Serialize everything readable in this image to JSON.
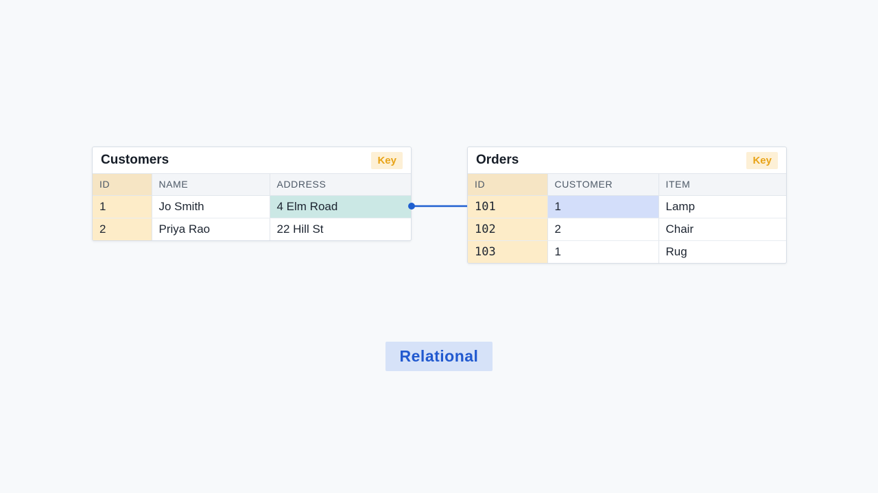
{
  "colors": {
    "background": "#f7f9fb",
    "key_accent": "#e8a317",
    "key_cell": "#fdecc8",
    "link_line": "#1f5fd0",
    "address_highlight": "#cbe8e5",
    "customer_ref_highlight": "#d3defa",
    "label_text": "#2159cf",
    "label_bg": "#d6e2f8"
  },
  "customers": {
    "title": "Customers",
    "key_label": "Key",
    "columns": [
      "ID",
      "NAME",
      "ADDRESS"
    ],
    "rows": [
      [
        "1",
        "Jo Smith",
        "4 Elm Road"
      ],
      [
        "2",
        "Priya Rao",
        "22 Hill St"
      ]
    ]
  },
  "orders": {
    "title": "Orders",
    "key_label": "Key",
    "columns": [
      "ID",
      "CUSTOMER",
      "ITEM"
    ],
    "rows": [
      [
        "101",
        "1",
        "Lamp"
      ],
      [
        "102",
        "2",
        "Chair"
      ],
      [
        "103",
        "1",
        "Rug"
      ]
    ]
  },
  "link": {
    "from": "customers.rows.0.2",
    "to": "orders.rows.0.1"
  },
  "model_label": "Relational"
}
